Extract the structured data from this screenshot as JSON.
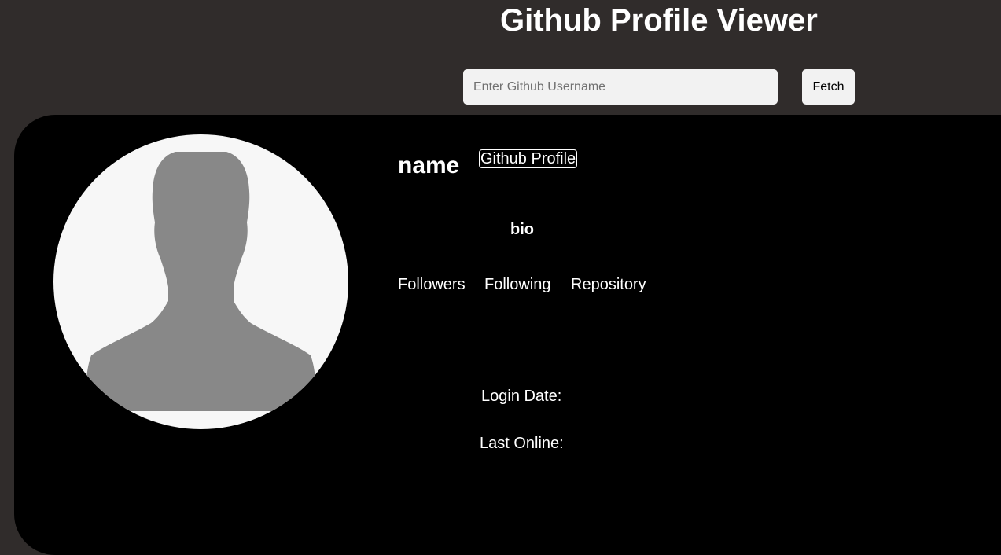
{
  "header": {
    "title": "Github Profile Viewer"
  },
  "search": {
    "placeholder": "Enter Github Username",
    "value": "",
    "button_label": "Fetch"
  },
  "profile": {
    "avatar_icon": "default-user-silhouette-icon",
    "name": "name",
    "link_label": "Github Profile",
    "bio": "bio",
    "stats": {
      "followers_label": "Followers",
      "following_label": "Following",
      "repository_label": "Repository"
    },
    "login_date_label": "Login Date:",
    "last_online_label": "Last Online:"
  },
  "colors": {
    "page_background": "#302c2b",
    "card_background": "#000000",
    "text": "#ffffff",
    "input_background": "#f2f2f2",
    "avatar_background": "#f7f7f7",
    "avatar_silhouette": "#888888"
  }
}
